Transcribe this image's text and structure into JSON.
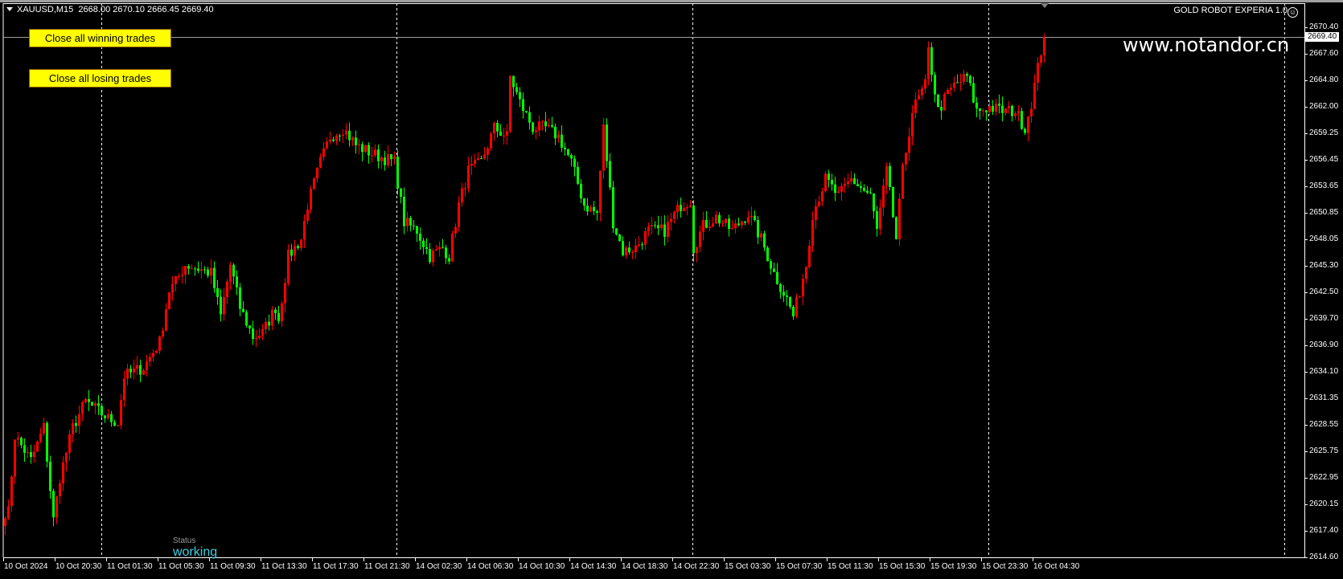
{
  "header": {
    "symbol": "XAUUSD,M15",
    "ohlc": "2668.00 2670.10 2666.45 2669.40",
    "ea_name": "GOLD ROBOT EXPERIA 1.0",
    "watermark": "www.notandor.cn"
  },
  "buttons": {
    "close_winning": "Close all winning trades",
    "close_losing": "Close all losing trades"
  },
  "status": {
    "label": "Status",
    "value": "working"
  },
  "colors": {
    "bull": "#ff0000",
    "bear": "#00ff00",
    "background": "#000000",
    "button": "#ffff00",
    "status": "#3fd0e0"
  },
  "chart_data": {
    "type": "candlestick",
    "timeframe": "M15",
    "current_price": "2669.40",
    "ylim": [
      2614.6,
      2670.4
    ],
    "y_ticks": [
      "2670.40",
      "2667.60",
      "2664.80",
      "2662.00",
      "2659.25",
      "2656.45",
      "2653.65",
      "2650.85",
      "2648.05",
      "2645.30",
      "2642.50",
      "2639.70",
      "2636.90",
      "2634.10",
      "2631.35",
      "2628.55",
      "2625.75",
      "2622.95",
      "2620.15",
      "2617.40",
      "2614.60"
    ],
    "x_ticks": [
      "10 Oct 2024",
      "10 Oct 20:30",
      "11 Oct 01:30",
      "11 Oct 05:30",
      "11 Oct 09:30",
      "11 Oct 13:30",
      "11 Oct 17:30",
      "11 Oct 21:30",
      "14 Oct 02:30",
      "14 Oct 06:30",
      "14 Oct 10:30",
      "14 Oct 14:30",
      "14 Oct 18:30",
      "14 Oct 22:30",
      "15 Oct 03:30",
      "15 Oct 07:30",
      "15 Oct 11:30",
      "15 Oct 15:30",
      "15 Oct 19:30",
      "15 Oct 23:30",
      "16 Oct 04:30"
    ],
    "close_path": [
      [
        1,
        2619.4
      ],
      [
        3,
        2627.4
      ],
      [
        8,
        2624.8
      ],
      [
        12,
        2628.3
      ],
      [
        15,
        2618.5
      ],
      [
        17,
        2623.0
      ],
      [
        21,
        2628.3
      ],
      [
        25,
        2631.0
      ],
      [
        32,
        2629.2
      ],
      [
        35,
        2628.8
      ],
      [
        37,
        2633.7
      ],
      [
        43,
        2634.6
      ],
      [
        48,
        2637.3
      ],
      [
        51,
        2642.7
      ],
      [
        53,
        2643.6
      ],
      [
        56,
        2645.4
      ],
      [
        60,
        2645.0
      ],
      [
        64,
        2644.5
      ],
      [
        67,
        2640.0
      ],
      [
        70,
        2645.4
      ],
      [
        73,
        2640.9
      ],
      [
        77,
        2637.8
      ],
      [
        80,
        2638.2
      ],
      [
        84,
        2640.9
      ],
      [
        85,
        2639.6
      ],
      [
        88,
        2646.3
      ],
      [
        92,
        2648.1
      ],
      [
        94,
        2651.7
      ],
      [
        98,
        2656.2
      ],
      [
        101,
        2658.9
      ],
      [
        105,
        2659.8
      ],
      [
        109,
        2658.0
      ],
      [
        114,
        2657.1
      ],
      [
        121,
        2656.2
      ],
      [
        124,
        2649.9
      ],
      [
        128,
        2649.0
      ],
      [
        132,
        2646.3
      ],
      [
        136,
        2647.2
      ],
      [
        138,
        2646.3
      ],
      [
        141,
        2651.7
      ],
      [
        144,
        2655.3
      ],
      [
        148,
        2656.2
      ],
      [
        152,
        2659.8
      ],
      [
        156,
        2658.9
      ],
      [
        157,
        2665.2
      ],
      [
        160,
        2662.5
      ],
      [
        164,
        2659.8
      ],
      [
        168,
        2659.8
      ],
      [
        172,
        2658.9
      ],
      [
        176,
        2656.2
      ],
      [
        180,
        2651.7
      ],
      [
        184,
        2650.8
      ],
      [
        186,
        2659.8
      ],
      [
        189,
        2649.9
      ],
      [
        192,
        2646.8
      ],
      [
        196,
        2647.2
      ],
      [
        200,
        2649.0
      ],
      [
        205,
        2649.0
      ],
      [
        210,
        2651.7
      ],
      [
        213,
        2652.2
      ],
      [
        214,
        2647.2
      ],
      [
        217,
        2649.5
      ],
      [
        221,
        2650.4
      ],
      [
        226,
        2649.0
      ],
      [
        231,
        2650.8
      ],
      [
        235,
        2648.1
      ],
      [
        239,
        2644.5
      ],
      [
        243,
        2641.8
      ],
      [
        245,
        2640.0
      ],
      [
        249,
        2645.4
      ],
      [
        251,
        2650.8
      ],
      [
        255,
        2654.4
      ],
      [
        259,
        2652.6
      ],
      [
        263,
        2654.4
      ],
      [
        269,
        2652.6
      ],
      [
        271,
        2649.0
      ],
      [
        274,
        2655.3
      ],
      [
        277,
        2648.1
      ],
      [
        279,
        2655.3
      ],
      [
        282,
        2661.6
      ],
      [
        286,
        2664.3
      ],
      [
        287,
        2667.9
      ],
      [
        290,
        2661.6
      ],
      [
        293,
        2663.4
      ],
      [
        295,
        2664.3
      ],
      [
        299,
        2665.2
      ],
      [
        302,
        2661.6
      ],
      [
        306,
        2662.0
      ],
      [
        310,
        2661.6
      ],
      [
        314,
        2661.6
      ],
      [
        317,
        2659.8
      ],
      [
        319,
        2662.5
      ],
      [
        322,
        2667.9
      ],
      [
        323,
        2669.4
      ]
    ]
  }
}
